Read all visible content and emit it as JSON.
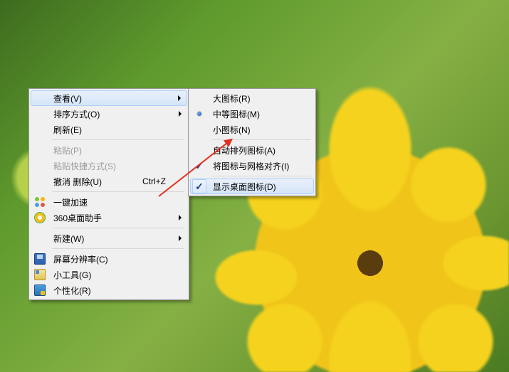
{
  "main_menu": {
    "view": {
      "label": "查看(V)"
    },
    "sort": {
      "label": "排序方式(O)"
    },
    "refresh": {
      "label": "刷新(E)"
    },
    "paste": {
      "label": "粘贴(P)"
    },
    "paste_link": {
      "label": "粘贴快捷方式(S)"
    },
    "undo": {
      "label": "撤消 删除(U)",
      "shortcut": "Ctrl+Z"
    },
    "accel": {
      "label": "一键加速"
    },
    "helper360": {
      "label": "360桌面助手"
    },
    "new": {
      "label": "新建(W)"
    },
    "resolution": {
      "label": "屏幕分辨率(C)"
    },
    "gadgets": {
      "label": "小工具(G)"
    },
    "personalize": {
      "label": "个性化(R)"
    }
  },
  "view_submenu": {
    "large": {
      "label": "大图标(R)"
    },
    "medium": {
      "label": "中等图标(M)"
    },
    "small": {
      "label": "小图标(N)"
    },
    "auto": {
      "label": "自动排列图标(A)"
    },
    "grid": {
      "label": "将图标与网格对齐(I)"
    },
    "show": {
      "label": "显示桌面图标(D)"
    }
  }
}
